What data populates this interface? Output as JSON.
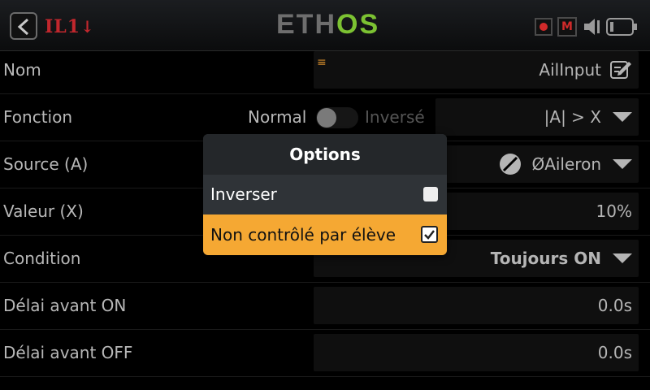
{
  "header": {
    "model_name": "IL1",
    "brand_left": "ETH",
    "brand_right": "OS",
    "icons": [
      "back-icon",
      "record-icon",
      "mute-icon",
      "volume-icon",
      "battery-icon"
    ],
    "brand_accent": "#7cc232"
  },
  "rows": {
    "nom": {
      "label": "Nom",
      "value": "AilInput"
    },
    "fonction": {
      "label": "Fonction",
      "toggle_left": "Normal",
      "toggle_right": "Inversé",
      "value": "|A| > X"
    },
    "source": {
      "label": "Source (A)",
      "value": "ØAileron"
    },
    "valeur": {
      "label": "Valeur (X)",
      "value": "10%"
    },
    "condition": {
      "label": "Condition",
      "value": "Toujours ON"
    },
    "delai_on": {
      "label": "Délai avant ON",
      "value": "0.0s"
    },
    "delai_off": {
      "label": "Délai avant OFF",
      "value": "0.0s"
    }
  },
  "modal": {
    "title": "Options",
    "items": [
      {
        "label": "Inverser",
        "checked": false
      },
      {
        "label": "Non contrôlé par élève",
        "checked": true
      }
    ],
    "highlight_color": "#f5a833"
  }
}
